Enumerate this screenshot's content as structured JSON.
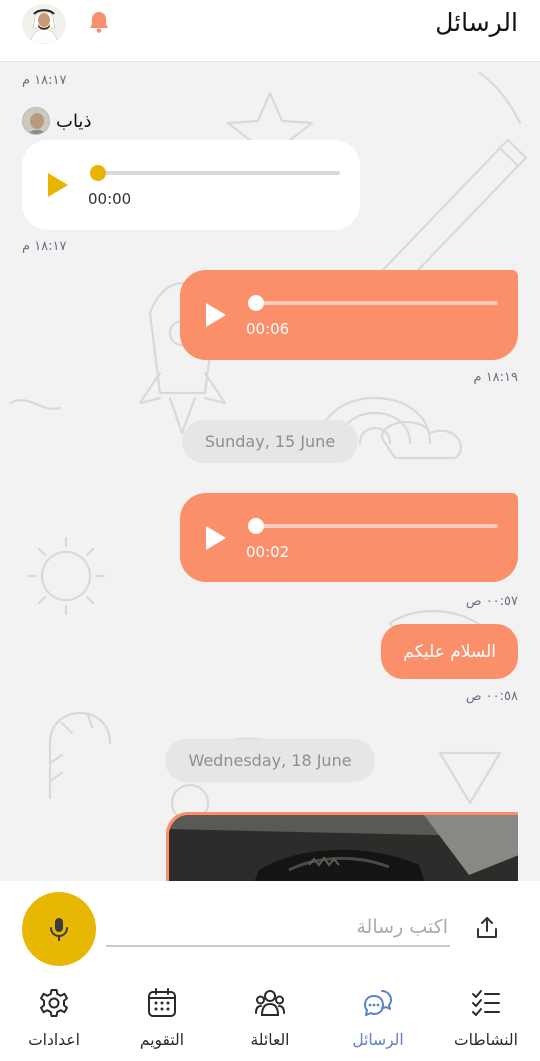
{
  "header": {
    "title": "الرسائل",
    "accent_color": "#fa8f6a",
    "icons": {
      "bell": "bell-icon",
      "avatar": "user-avatar"
    }
  },
  "messages": [
    {
      "type": "audio",
      "direction": "in",
      "sender": "ذياب",
      "time_above": "١٨:١٧ م",
      "duration": "00:00",
      "progress": 0.0,
      "time_below": "١٨:١٧ م"
    },
    {
      "type": "audio",
      "direction": "out",
      "duration": "00:06",
      "progress": 0.0,
      "time": "١٨:١٩ م"
    },
    {
      "type": "date",
      "label": "Sunday, 15 June"
    },
    {
      "type": "audio",
      "direction": "out",
      "duration": "00:02",
      "progress": 0.0,
      "time": "٠٠:٥٧ ص"
    },
    {
      "type": "text",
      "direction": "out",
      "text": "السلام عليكم",
      "time": "٠٠:٥٨ ص"
    },
    {
      "type": "date",
      "label": "Wednesday, 18 June"
    },
    {
      "type": "image",
      "direction": "out"
    }
  ],
  "composer": {
    "placeholder": "اكتب رسالة",
    "value": "",
    "mic_color": "#e8b703",
    "icons": {
      "mic": "mic-icon",
      "upload": "upload-icon"
    }
  },
  "tabs": [
    {
      "label": "اعدادات",
      "icon": "gear-icon",
      "active": false
    },
    {
      "label": "التقويم",
      "icon": "calendar-icon",
      "active": false
    },
    {
      "label": "العائلة",
      "icon": "family-icon",
      "active": false
    },
    {
      "label": "الرسائل",
      "icon": "chat-icon",
      "active": true
    },
    {
      "label": "النشاطات",
      "icon": "checklist-icon",
      "active": false
    }
  ],
  "colors": {
    "active_tab": "#5b81cc",
    "incoming_bubble": "#ffffff",
    "outgoing_bubble": "#fa8f6a",
    "play_incoming": "#e7b400"
  }
}
